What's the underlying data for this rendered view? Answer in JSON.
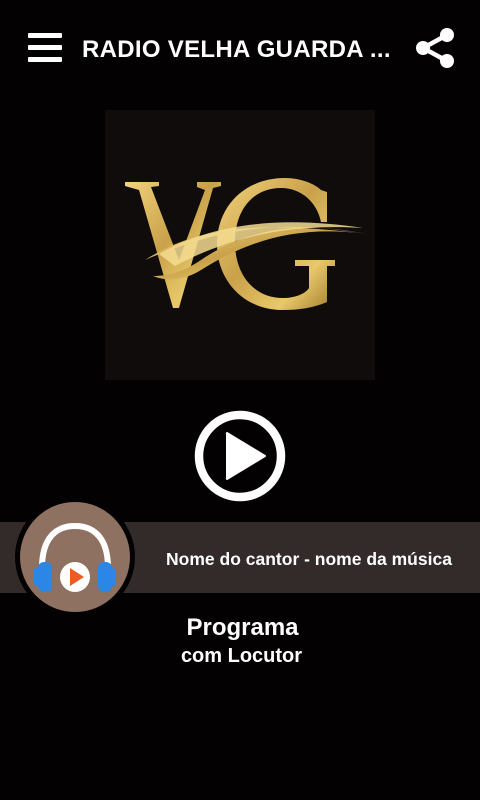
{
  "header": {
    "title": "RADIO VELHA GUARDA ...",
    "menu_icon": "hamburger-menu-icon",
    "share_icon": "share-icon"
  },
  "logo": {
    "text": "VG",
    "color": "#c9a14a"
  },
  "player": {
    "play_icon": "play-icon",
    "track": "Nome do cantor - nome da música",
    "album_art_icon": "headphones-play-icon"
  },
  "program": {
    "name": "Programa",
    "host": "com Locutor"
  },
  "colors": {
    "background": "#040102",
    "band": "#332a2a",
    "art_circle": "#8e7161",
    "headphone_blue": "#2b86e6",
    "play_orange": "#ef5a24"
  }
}
